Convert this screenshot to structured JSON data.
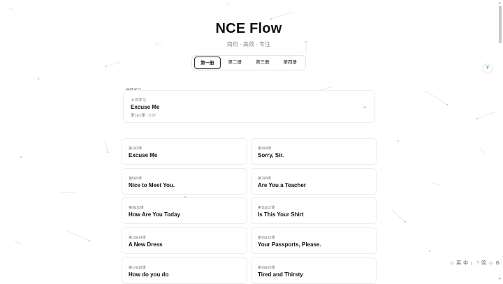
{
  "header": {
    "title": "NCE Flow",
    "subtitle": "简约 · 高效 · 专注"
  },
  "tabs": [
    {
      "label": "第一册",
      "active": true
    },
    {
      "label": "第二册",
      "active": false
    },
    {
      "label": "第三册",
      "active": false
    },
    {
      "label": "第四册",
      "active": false
    }
  ],
  "continue": {
    "section_label": "继续学习",
    "kicker": "上次学习",
    "title": "Excuse Me",
    "meta": "第1&2课 · 0:37",
    "arrow": "→"
  },
  "lessons": [
    {
      "number": "第1&2课",
      "title": "Excuse Me"
    },
    {
      "number": "第3&4课",
      "title": "Sorry, Sir."
    },
    {
      "number": "第5&6课",
      "title": "Nice to Meet You."
    },
    {
      "number": "第7&8课",
      "title": "Are You a Teacher"
    },
    {
      "number": "第9&10课",
      "title": "How Are You Today"
    },
    {
      "number": "第11&12课",
      "title": "Is This Your Shirt"
    },
    {
      "number": "第13&14课",
      "title": "A New Dress"
    },
    {
      "number": "第15&16课",
      "title": "Your Passports, Please."
    },
    {
      "number": "第17&18课",
      "title": "How do you do"
    },
    {
      "number": "第19&20课",
      "title": "Tired and Thirsty"
    }
  ],
  "extension": {
    "icon": "Y"
  },
  "ime": {
    "items": [
      "☺",
      "英",
      "中",
      "♪",
      "☽",
      "简",
      "☺",
      "⚙"
    ]
  }
}
